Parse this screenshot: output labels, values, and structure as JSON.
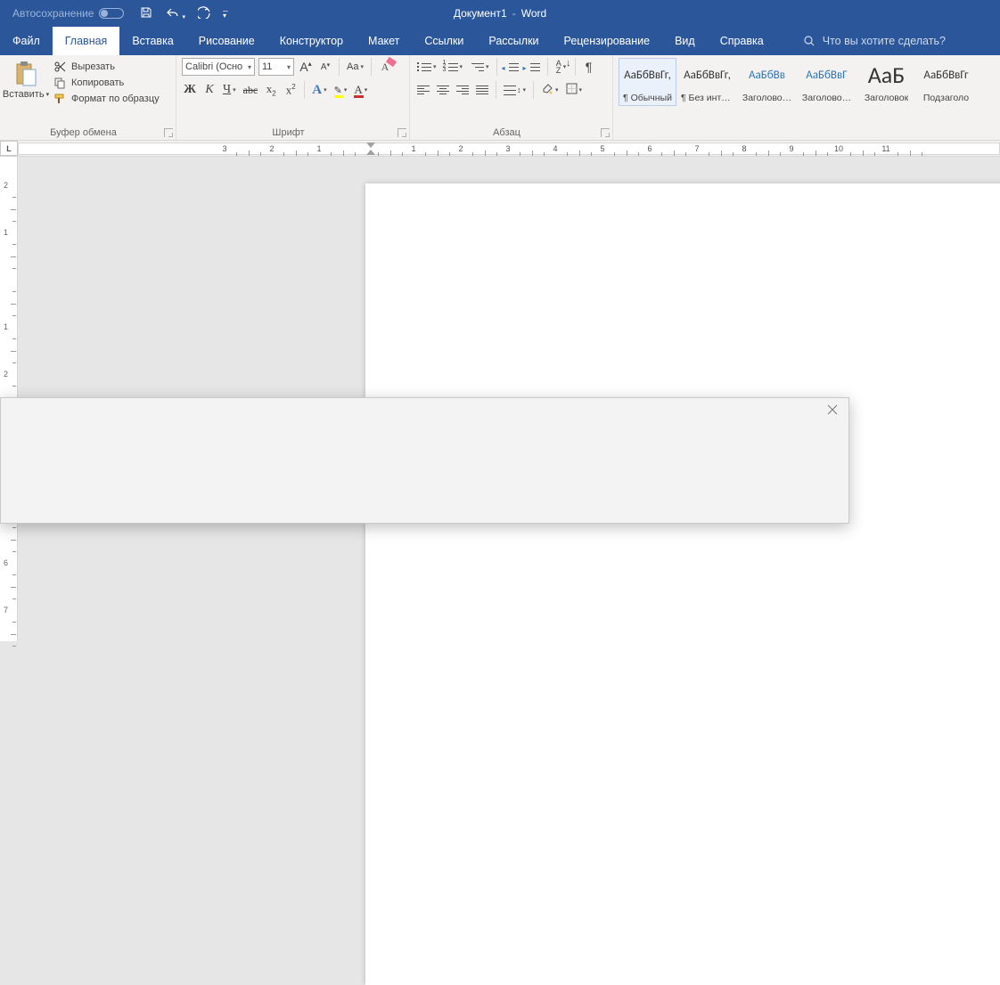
{
  "titlebar": {
    "autosave": "Автосохранение",
    "doc": "Документ1",
    "app": "Word"
  },
  "tabs": {
    "file": "Файл",
    "home": "Главная",
    "insert": "Вставка",
    "draw": "Рисование",
    "design": "Конструктор",
    "layout": "Макет",
    "references": "Ссылки",
    "mailings": "Рассылки",
    "review": "Рецензирование",
    "view": "Вид",
    "help": "Справка",
    "tellme": "Что вы хотите сделать?"
  },
  "ribbon": {
    "clipboard": {
      "paste": "Вставить",
      "cut": "Вырезать",
      "copy": "Копировать",
      "format": "Формат по образцу",
      "group": "Буфер обмена"
    },
    "font": {
      "name": "Calibri (Осно",
      "size": "11",
      "group": "Шрифт",
      "caseBtn": "Aa"
    },
    "paragraph": {
      "group": "Абзац"
    },
    "styles": {
      "items": [
        {
          "sample": "АаБбВвГг,",
          "name": "¶ Обычный",
          "cls": ""
        },
        {
          "sample": "АаБбВвГг,",
          "name": "¶ Без инте…",
          "cls": ""
        },
        {
          "sample": "АаБбВв",
          "name": "Заголово…",
          "cls": "blue"
        },
        {
          "sample": "АаБбВвГ",
          "name": "Заголово…",
          "cls": "blue"
        },
        {
          "sample": "АаБ",
          "name": "Заголовок",
          "cls": "big"
        },
        {
          "sample": "АаБбВвГг",
          "name": "Подзаголо",
          "cls": ""
        }
      ]
    }
  },
  "ruler": {
    "h": [
      "3",
      "2",
      "1",
      "1",
      "2",
      "3",
      "4",
      "5",
      "6",
      "7",
      "8",
      "9",
      "10"
    ],
    "v": [
      "2",
      "1",
      "1",
      "2"
    ]
  }
}
